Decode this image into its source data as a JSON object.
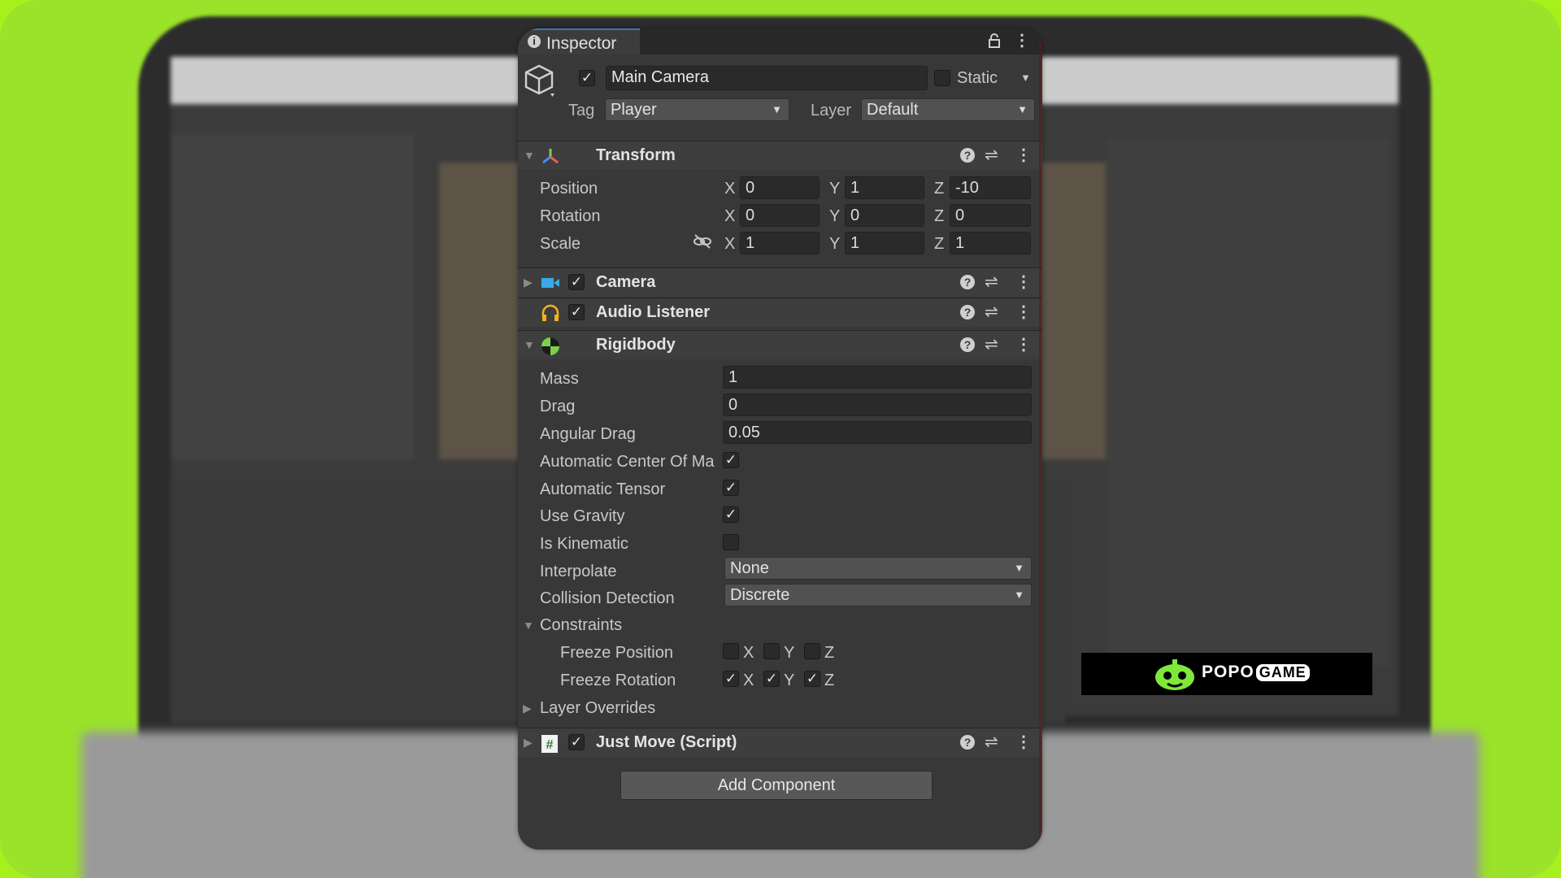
{
  "window": {
    "tab_label": "Inspector"
  },
  "gameobject": {
    "name": "Main Camera",
    "active": true,
    "static_label": "Static",
    "static": false,
    "tag_label": "Tag",
    "tag_value": "Player",
    "layer_label": "Layer",
    "layer_value": "Default"
  },
  "transform": {
    "title": "Transform",
    "rows": [
      {
        "label": "Position",
        "x": "0",
        "y": "1",
        "z": "-10"
      },
      {
        "label": "Rotation",
        "x": "0",
        "y": "0",
        "z": "0"
      },
      {
        "label": "Scale",
        "x": "1",
        "y": "1",
        "z": "1"
      }
    ],
    "axes": {
      "x": "X",
      "y": "Y",
      "z": "Z"
    }
  },
  "camera": {
    "title": "Camera",
    "enabled": true
  },
  "audio_listener": {
    "title": "Audio Listener",
    "enabled": true
  },
  "rigidbody": {
    "title": "Rigidbody",
    "mass_label": "Mass",
    "mass": "1",
    "drag_label": "Drag",
    "drag": "0",
    "angular_drag_label": "Angular Drag",
    "angular_drag": "0.05",
    "auto_com_label": "Automatic Center Of Ma",
    "auto_com": true,
    "auto_tensor_label": "Automatic Tensor",
    "auto_tensor": true,
    "use_gravity_label": "Use Gravity",
    "use_gravity": true,
    "is_kinematic_label": "Is Kinematic",
    "is_kinematic": false,
    "interpolate_label": "Interpolate",
    "interpolate": "None",
    "collision_label": "Collision Detection",
    "collision": "Discrete",
    "constraints_label": "Constraints",
    "freeze_position_label": "Freeze Position",
    "freeze_rotation_label": "Freeze Rotation",
    "freeze_position": {
      "x": false,
      "y": false,
      "z": false
    },
    "freeze_rotation": {
      "x": true,
      "y": true,
      "z": true
    },
    "layer_overrides_label": "Layer Overrides"
  },
  "script": {
    "title": "Just Move (Script)",
    "enabled": true
  },
  "add_component_label": "Add Component",
  "watermark": {
    "brand": "POPO",
    "brand2": "GAME"
  },
  "icons": {
    "tab": "info-icon",
    "lock": "lock-icon",
    "gameobject": "cube-icon",
    "scale_link": "unlink-icon"
  }
}
